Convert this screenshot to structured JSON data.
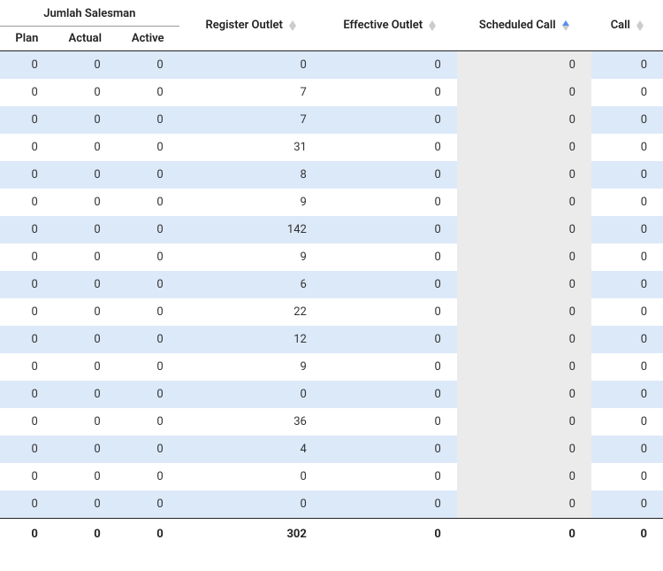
{
  "table": {
    "group_header": "Jumlah Salesman",
    "columns": {
      "plan": "Plan",
      "actual": "Actual",
      "active": "Active",
      "register_outlet": "Register Outlet",
      "effective_outlet": "Effective Outlet",
      "scheduled_call": "Scheduled Call",
      "call": "Call"
    },
    "rows": [
      {
        "plan": 0,
        "actual": 0,
        "active": 0,
        "register_outlet": 0,
        "effective_outlet": 0,
        "scheduled_call": 0,
        "call": 0
      },
      {
        "plan": 0,
        "actual": 0,
        "active": 0,
        "register_outlet": 7,
        "effective_outlet": 0,
        "scheduled_call": 0,
        "call": 0
      },
      {
        "plan": 0,
        "actual": 0,
        "active": 0,
        "register_outlet": 7,
        "effective_outlet": 0,
        "scheduled_call": 0,
        "call": 0
      },
      {
        "plan": 0,
        "actual": 0,
        "active": 0,
        "register_outlet": 31,
        "effective_outlet": 0,
        "scheduled_call": 0,
        "call": 0
      },
      {
        "plan": 0,
        "actual": 0,
        "active": 0,
        "register_outlet": 8,
        "effective_outlet": 0,
        "scheduled_call": 0,
        "call": 0
      },
      {
        "plan": 0,
        "actual": 0,
        "active": 0,
        "register_outlet": 9,
        "effective_outlet": 0,
        "scheduled_call": 0,
        "call": 0
      },
      {
        "plan": 0,
        "actual": 0,
        "active": 0,
        "register_outlet": 142,
        "effective_outlet": 0,
        "scheduled_call": 0,
        "call": 0
      },
      {
        "plan": 0,
        "actual": 0,
        "active": 0,
        "register_outlet": 9,
        "effective_outlet": 0,
        "scheduled_call": 0,
        "call": 0
      },
      {
        "plan": 0,
        "actual": 0,
        "active": 0,
        "register_outlet": 6,
        "effective_outlet": 0,
        "scheduled_call": 0,
        "call": 0
      },
      {
        "plan": 0,
        "actual": 0,
        "active": 0,
        "register_outlet": 22,
        "effective_outlet": 0,
        "scheduled_call": 0,
        "call": 0
      },
      {
        "plan": 0,
        "actual": 0,
        "active": 0,
        "register_outlet": 12,
        "effective_outlet": 0,
        "scheduled_call": 0,
        "call": 0
      },
      {
        "plan": 0,
        "actual": 0,
        "active": 0,
        "register_outlet": 9,
        "effective_outlet": 0,
        "scheduled_call": 0,
        "call": 0
      },
      {
        "plan": 0,
        "actual": 0,
        "active": 0,
        "register_outlet": 0,
        "effective_outlet": 0,
        "scheduled_call": 0,
        "call": 0
      },
      {
        "plan": 0,
        "actual": 0,
        "active": 0,
        "register_outlet": 36,
        "effective_outlet": 0,
        "scheduled_call": 0,
        "call": 0
      },
      {
        "plan": 0,
        "actual": 0,
        "active": 0,
        "register_outlet": 4,
        "effective_outlet": 0,
        "scheduled_call": 0,
        "call": 0
      },
      {
        "plan": 0,
        "actual": 0,
        "active": 0,
        "register_outlet": 0,
        "effective_outlet": 0,
        "scheduled_call": 0,
        "call": 0
      },
      {
        "plan": 0,
        "actual": 0,
        "active": 0,
        "register_outlet": 0,
        "effective_outlet": 0,
        "scheduled_call": 0,
        "call": 0
      }
    ],
    "footer": {
      "plan": 0,
      "actual": 0,
      "active": 0,
      "register_outlet": 302,
      "effective_outlet": 0,
      "scheduled_call": 0,
      "call": 0
    }
  }
}
